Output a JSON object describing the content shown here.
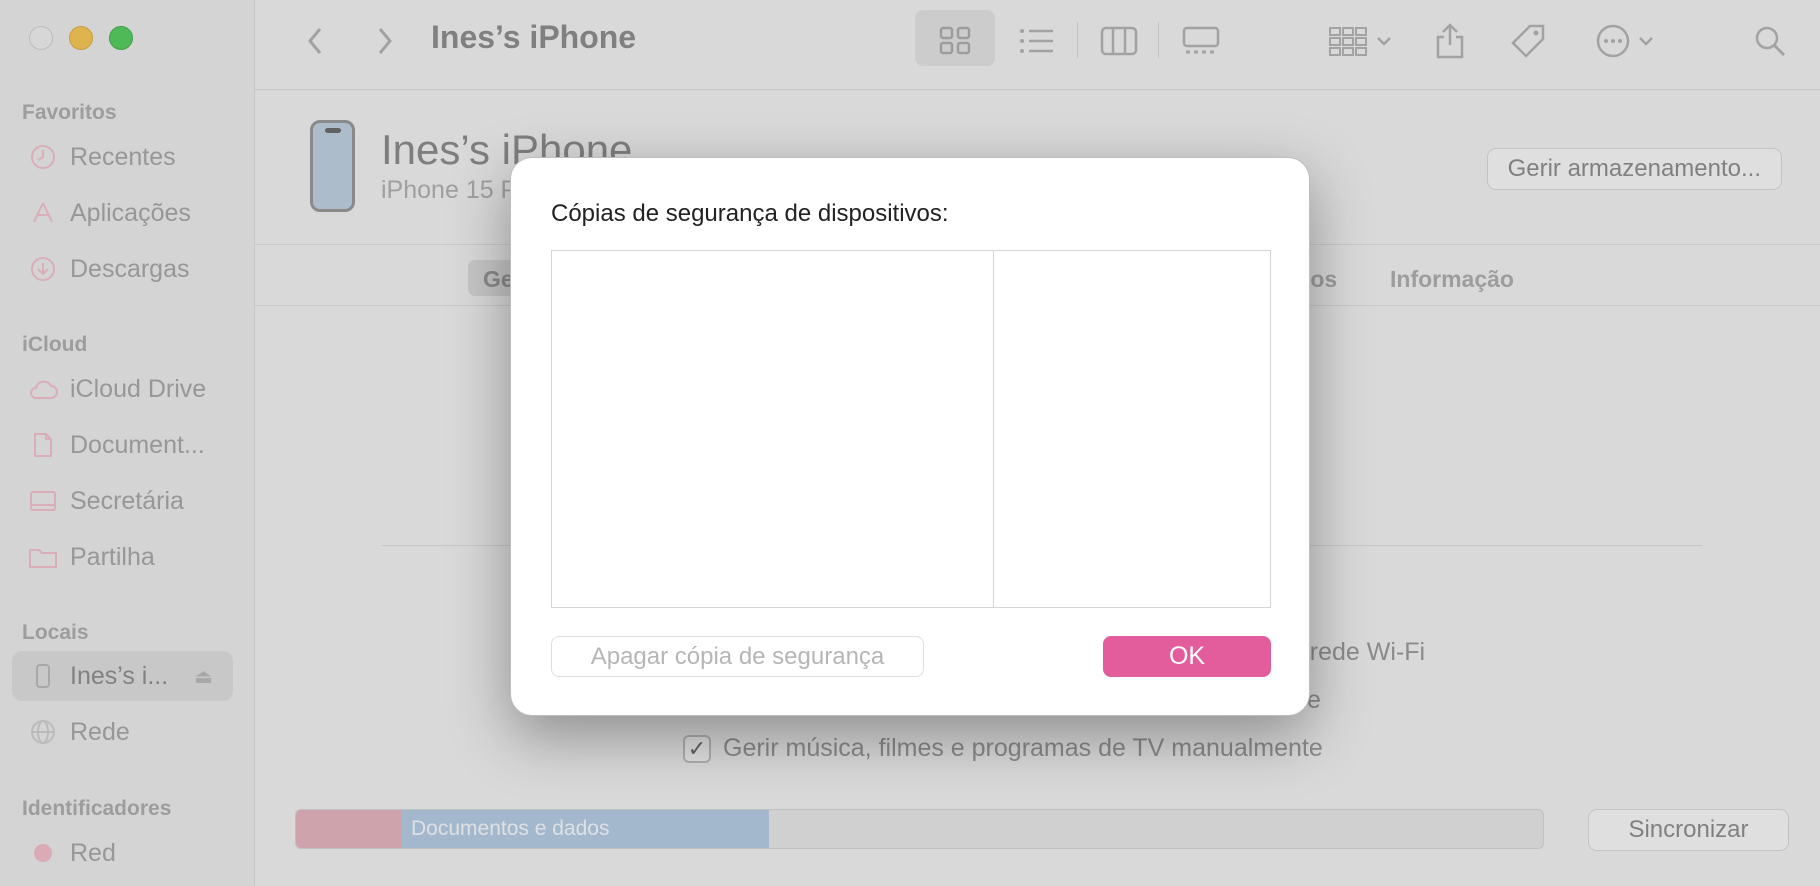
{
  "window": {
    "title": "Ines’s iPhone"
  },
  "sidebar": {
    "sections": [
      {
        "title": "Favoritos",
        "items": [
          {
            "label": "Recentes",
            "icon": "clock-icon"
          },
          {
            "label": "Aplicações",
            "icon": "applications-icon"
          },
          {
            "label": "Descargas",
            "icon": "download-icon"
          }
        ]
      },
      {
        "title": "iCloud",
        "items": [
          {
            "label": "iCloud Drive",
            "icon": "cloud-icon"
          },
          {
            "label": "Document...",
            "icon": "document-icon"
          },
          {
            "label": "Secretária",
            "icon": "desktop-icon"
          },
          {
            "label": "Partilha",
            "icon": "shared-folder-icon"
          }
        ]
      },
      {
        "title": "Locais",
        "items": [
          {
            "label": "Ines’s i...",
            "icon": "iphone-icon",
            "active": true
          },
          {
            "label": "Rede",
            "icon": "globe-icon"
          }
        ]
      },
      {
        "title": "Identificadores",
        "items": [
          {
            "label": "Red",
            "icon": "tag-dot-icon",
            "color": "#f0b3c0"
          }
        ]
      }
    ]
  },
  "toolbar": {
    "title": "Ines’s iPhone",
    "icons": [
      "back-icon",
      "forward-icon",
      "grid-view-icon",
      "list-view-icon",
      "column-view-icon",
      "gallery-view-icon",
      "group-icon",
      "share-icon",
      "tag-icon",
      "more-icon",
      "search-icon"
    ]
  },
  "device": {
    "name": "Ines’s iPhone",
    "model": "iPhone 15 P",
    "manage_storage": "Gerir armazenamento..."
  },
  "tabs": {
    "active": "Ge",
    "partial_right": "iros",
    "info": "Informação"
  },
  "options": {
    "wifi_line": "na rede Wi-Fi",
    "second_line": "e",
    "manage_manually": "Gerir música, filmes e programas de TV manualmente",
    "manage_checked": true
  },
  "storage_bar": {
    "segments": [
      {
        "label": "",
        "color": "#e2a9b4",
        "fraction": 0.084
      },
      {
        "label": "Documentos e dados",
        "color": "#aac4de",
        "fraction": 0.295
      }
    ]
  },
  "sync_button": "Sincronizar",
  "dialog": {
    "title": "Cópias de segurança de dispositivos:",
    "delete_button": "Apagar cópia de segurança",
    "ok_button": "OK",
    "accent": "#e35c9b"
  }
}
